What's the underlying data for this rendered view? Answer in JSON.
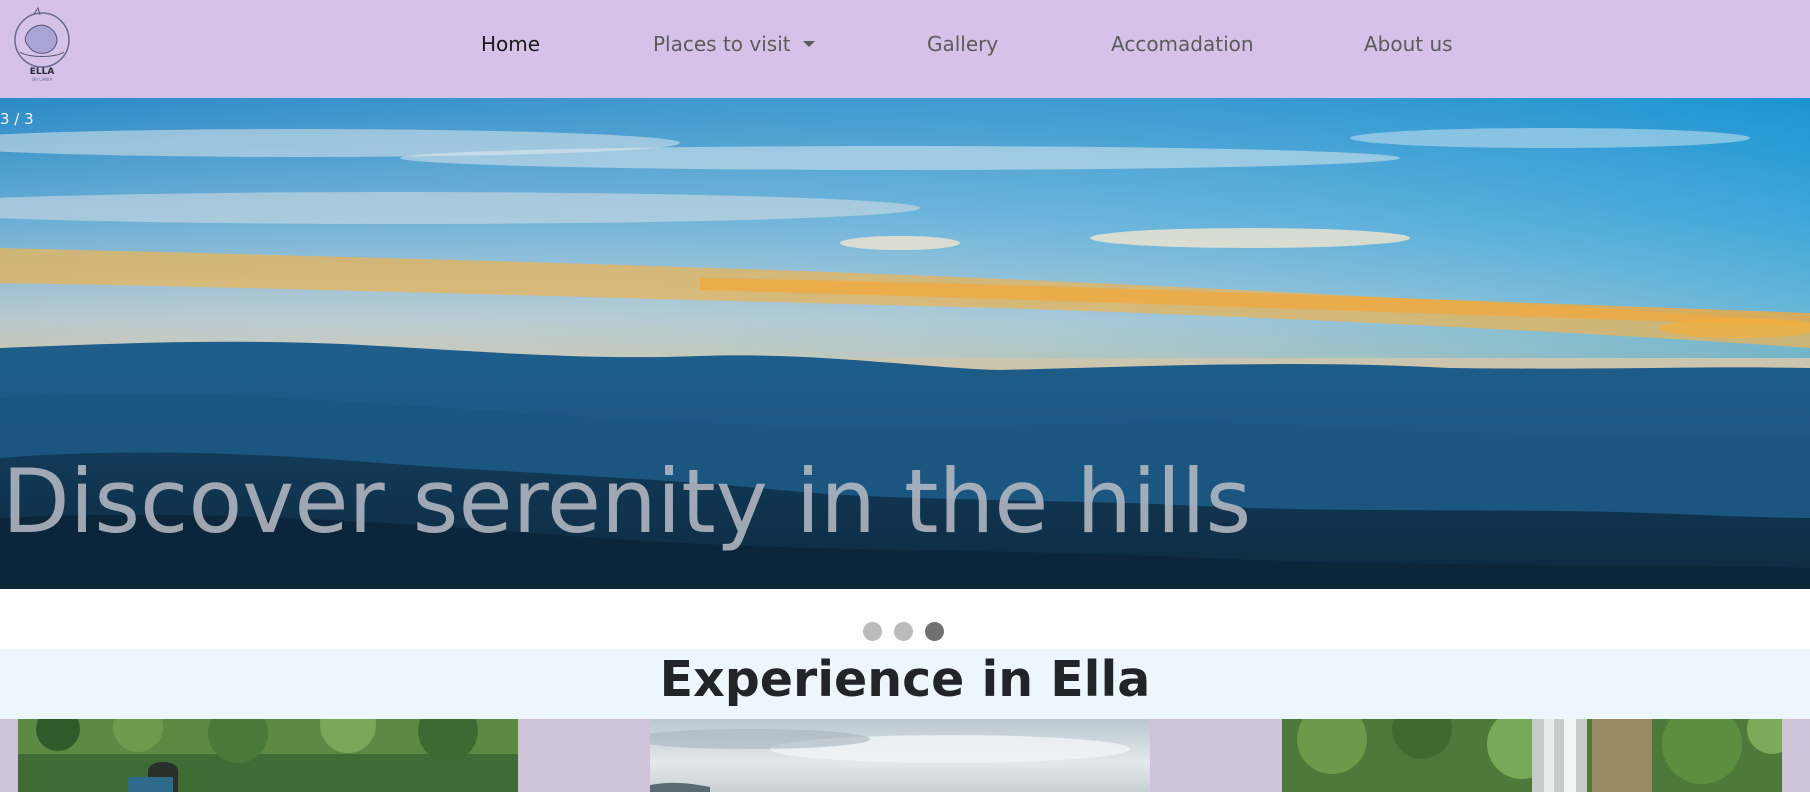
{
  "brand": {
    "logo_text": "ELLA",
    "logo_subtext": "SRI LANKA"
  },
  "nav": {
    "home": "Home",
    "places": "Places to visit",
    "gallery": "Gallery",
    "accommodation": "Accomadation",
    "about": "About us"
  },
  "hero": {
    "counter": "3 / 3",
    "caption": "Discover serenity in the hills"
  },
  "slider": {
    "slide_count": 3,
    "active_index": 3
  },
  "experience": {
    "title": "Experience in Ella"
  },
  "colors": {
    "navbar_bg": "#d6c2e8",
    "section_bg": "#eef6fd",
    "dot_inactive": "#bbbbbb",
    "dot_active": "#717171"
  }
}
